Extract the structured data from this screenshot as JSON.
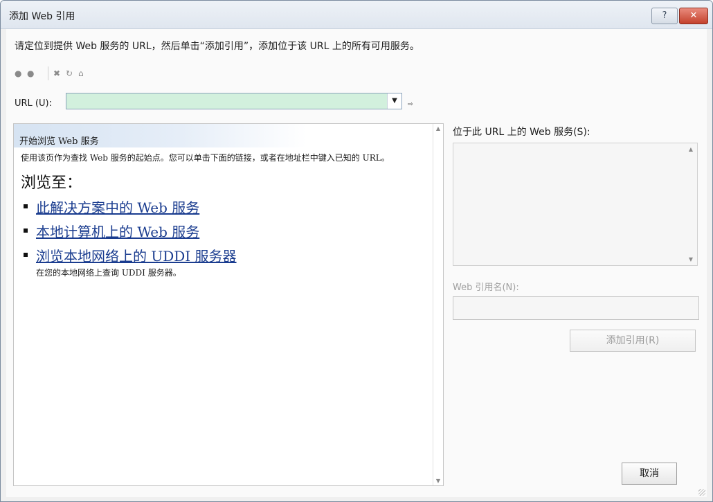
{
  "window": {
    "title": "添加 Web 引用",
    "help_glyph": "?",
    "close_glyph": "✕"
  },
  "instruction": "请定位到提供 Web 服务的 URL，然后单击“添加引用”，添加位于该 URL 上的所有可用服务。",
  "nav": {
    "back_icon": "back-icon",
    "forward_icon": "forward-icon",
    "stop_icon": "stop-icon",
    "refresh_icon": "refresh-icon",
    "home_icon": "home-icon"
  },
  "url": {
    "label": "URL (U):",
    "value": "",
    "dropdown_glyph": "▼",
    "go_glyph": "⇨"
  },
  "browser": {
    "banner_title": "开始浏览 Web 服务",
    "description": "使用该页作为查找 Web 服务的起始点。您可以单击下面的链接，或者在地址栏中键入已知的 URL。",
    "browse_heading": "浏览至：",
    "links": [
      {
        "label": "此解决方案中的 Web 服务",
        "sub": ""
      },
      {
        "label": "本地计算机上的 Web 服务",
        "sub": ""
      },
      {
        "label": "浏览本地网络上的 UDDI 服务器",
        "sub": "在您的本地网络上查询 UDDI 服务器。"
      }
    ]
  },
  "services": {
    "label": "位于此 URL 上的 Web 服务(S):",
    "items": []
  },
  "webref": {
    "label": "Web 引用名(N):",
    "value": ""
  },
  "buttons": {
    "add_reference": "添加引用(R)",
    "cancel": "取消"
  },
  "colors": {
    "url_box_bg": "#d2f0dd",
    "link": "#1a3c8f",
    "close_button": "#c4412c"
  }
}
